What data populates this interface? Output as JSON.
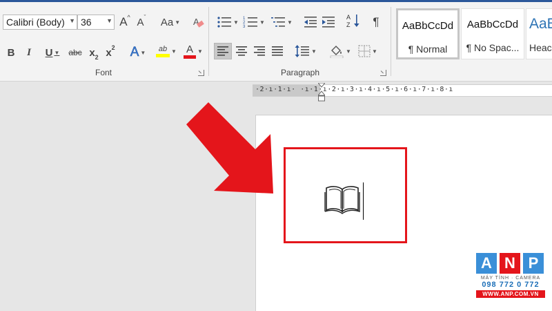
{
  "ribbon": {
    "font_group": {
      "label": "Font",
      "font_name": "Calibri (Body)",
      "font_size": "36",
      "grow_label": "A",
      "shrink_label": "A",
      "change_case_label": "Aa",
      "bold_label": "B",
      "italic_label": "I",
      "underline_label": "U",
      "strike_label": "abc",
      "subscript_label": "x",
      "superscript_label": "x",
      "subscript_digit": "2",
      "superscript_digit": "2",
      "text_effects_label": "A",
      "highlight_label": "ab",
      "font_color_label": "A",
      "highlight_color": "#ffff00",
      "font_color": "#e4151b"
    },
    "paragraph_group": {
      "label": "Paragraph",
      "pilcrow": "¶"
    },
    "styles": [
      {
        "sample": "AaBbCcDd",
        "name": "¶ Normal"
      },
      {
        "sample": "AaBbCcDd",
        "name": "¶ No Spac..."
      },
      {
        "sample": "AaBl",
        "name": "Heac"
      }
    ]
  },
  "ruler": {
    "text": "·2·ı·1·ı· ·ı·1·ı·2·ı·3·ı·4·ı·5·ı·6·ı·7·ı·8·ı"
  },
  "watermark": {
    "letters": [
      "A",
      "N",
      "P"
    ],
    "letter_colors": [
      "#3a8fd8",
      "#e4151b",
      "#3a8fd8"
    ],
    "subtitle": "MÁY TÍNH · CAMERA",
    "phone": "098 772 0 772",
    "url": "WWW.ANP.COM.VN"
  },
  "colors": {
    "accent": "#2b579a",
    "highlight_box": "#e4151b",
    "arrow": "#e4151b"
  }
}
